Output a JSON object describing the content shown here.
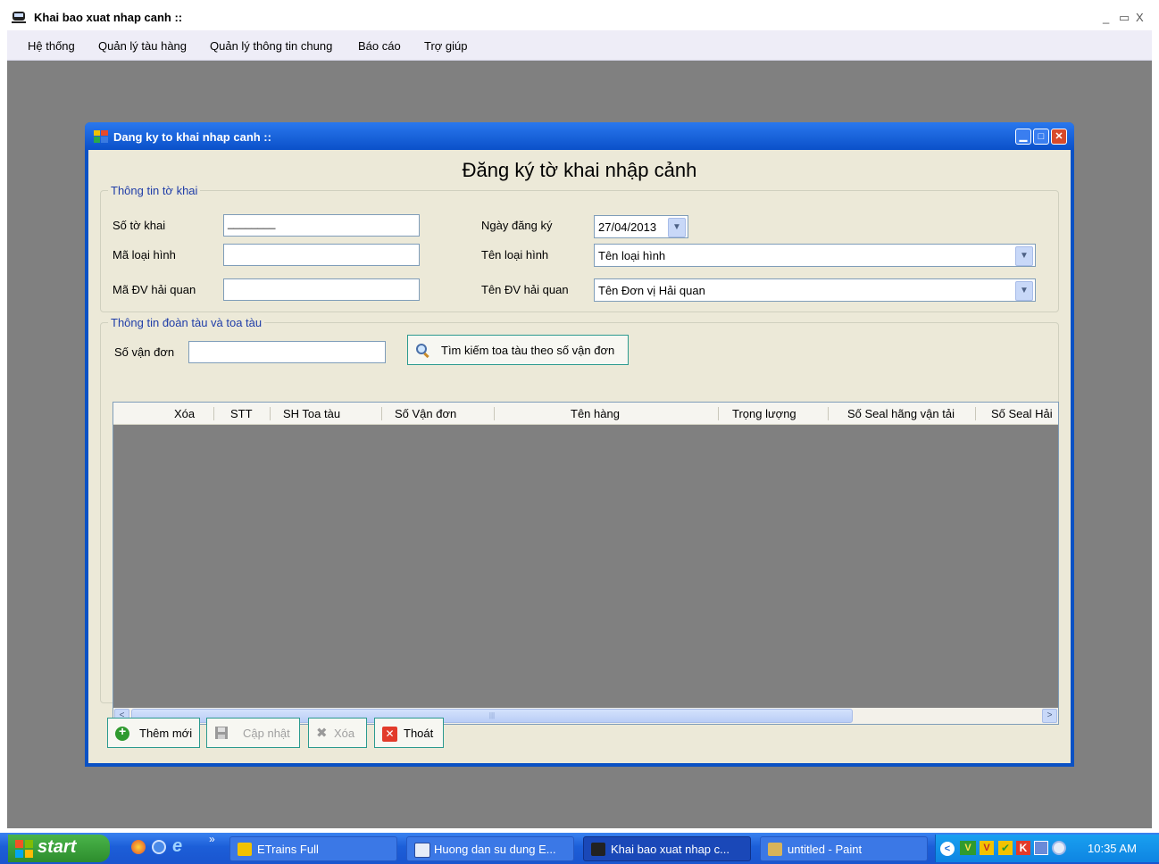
{
  "app": {
    "title": "Khai bao xuat nhap canh ::"
  },
  "window_controls": {
    "minimize": "_",
    "restore": "▭",
    "close": "X"
  },
  "menu": [
    "Hệ thống",
    "Quản lý tàu hàng",
    "Quản lý thông tin chung",
    "Báo cáo",
    "Trợ giúp"
  ],
  "child": {
    "title": "Dang ky to khai nhap canh ::",
    "heading": "Đăng ký tờ khai nhập cảnh",
    "group1": {
      "legend": "Thông tin tờ khai",
      "so_to_khai_label": "Số tờ khai",
      "so_to_khai_value": "________",
      "ma_loai_hinh_label": "Mã loại hình",
      "ma_dv_label": "Mã ĐV hải quan",
      "ngay_dk_label": "Ngày đăng ký",
      "ngay_dk_value": "27/04/2013",
      "ten_loai_hinh_label": "Tên loại hình",
      "ten_loai_hinh_value": "Tên loại hình",
      "ten_dv_label": "Tên ĐV hải quan",
      "ten_dv_value": "Tên Đơn vị Hải quan"
    },
    "group2": {
      "legend": "Thông tin đoàn tàu và toa tàu",
      "so_van_don_label": "Số vận đơn",
      "search_button": "Tìm kiếm toa tàu theo số vận đơn"
    },
    "grid": {
      "columns": [
        "Xóa",
        "STT",
        "SH Toa tàu",
        "Số Vận đơn",
        "Tên hàng",
        "Trọng lượng",
        "Số Seal hãng vận tải",
        "Số Seal Hải"
      ],
      "scroll_left": "<",
      "scroll_right": ">",
      "scroll_grip": "|||"
    },
    "buttons": {
      "add": "Thêm mới",
      "update": "Cập nhật",
      "delete": "Xóa",
      "exit": "Thoát"
    }
  },
  "taskbar": {
    "start": "start",
    "chevron": "»",
    "tasks": [
      "ETrains Full",
      "Huong dan su dung E...",
      "Khai bao xuat nhap c...",
      "untitled - Paint"
    ],
    "clock": "10:35 AM",
    "tray_labels": [
      "V",
      "V"
    ]
  },
  "colors": {
    "mdi_bg": "#808080",
    "title_blue": "#0a51c4",
    "form_bg": "#ece9d8",
    "taskbar": "#245edb",
    "start_green": "#3c9e3c"
  }
}
